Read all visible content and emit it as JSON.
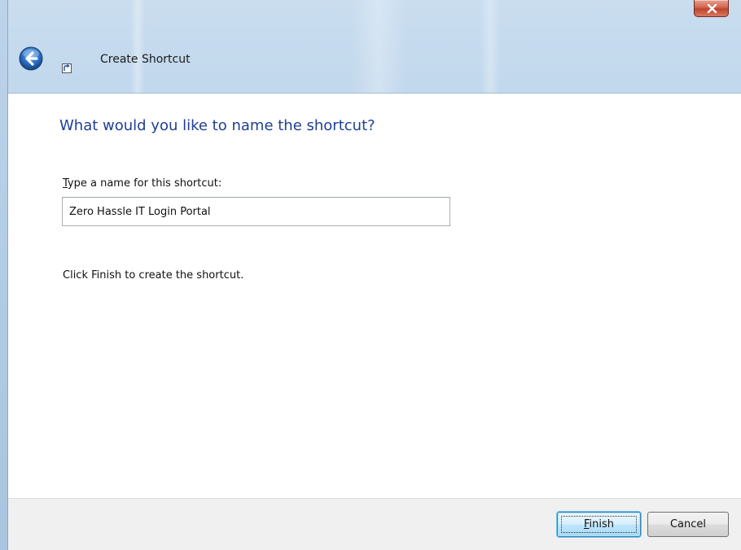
{
  "window": {
    "title": "Create Shortcut",
    "close_icon": "close-icon"
  },
  "nav": {
    "back_icon": "back-arrow-icon",
    "app_icon": "shortcut-icon"
  },
  "page": {
    "heading": "What would you like to name the shortcut?",
    "field_label_mnemonic": "T",
    "field_label_rest": "ype a name for this shortcut:",
    "name_value": "Zero Hassle IT Login Portal",
    "info": "Click Finish to create the shortcut."
  },
  "footer": {
    "finish_mnemonic": "F",
    "finish_rest": "inish",
    "cancel_label": "Cancel"
  },
  "colors": {
    "heading": "#1f3f95",
    "close_button": "#c0442c",
    "default_button_border": "#3c7fb1"
  }
}
